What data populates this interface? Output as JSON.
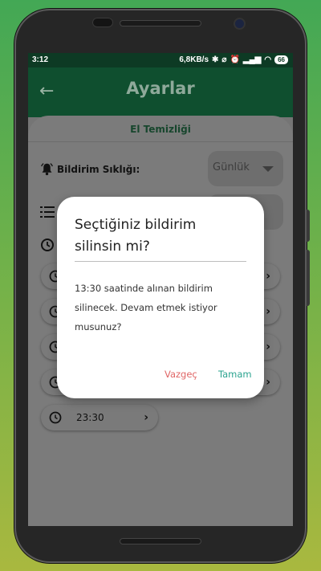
{
  "status_bar": {
    "time": "3:12",
    "speed": "6,8KB/s",
    "battery": "66"
  },
  "app_bar": {
    "title": "Ayarlar",
    "back_icon": "arrow-left-icon"
  },
  "card": {
    "title": "El Temizliği",
    "frequency_label": "Bildirim Sıklığı:",
    "frequency_value": "Günlük"
  },
  "reminder_times": [
    {
      "time": ""
    },
    {
      "time": ""
    },
    {
      "time": ""
    },
    {
      "time": ""
    },
    {
      "time": "23:30"
    }
  ],
  "dialog": {
    "title": "Seçtiğiniz bildirim silinsin mi?",
    "message": "13:30 saatinde alınan bildirim silinecek. Devam etmek istiyor musunuz?",
    "cancel_label": "Vazgeç",
    "ok_label": "Tamam",
    "cancel_color": "#e06666",
    "ok_color": "#2aa38f"
  },
  "colors": {
    "app_bar": "#0f4f2f",
    "status_bar": "#0d3a24"
  }
}
